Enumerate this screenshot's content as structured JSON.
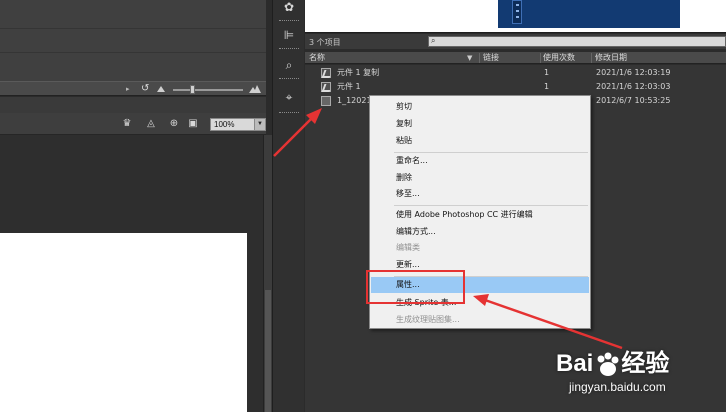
{
  "stage": {
    "zoom": "100%"
  },
  "library": {
    "item_count": "3 个项目",
    "search_placeholder": "",
    "columns": {
      "name": "名称",
      "linkage": "链接",
      "use_count": "使用次数",
      "modified": "修改日期"
    },
    "rows": [
      {
        "name": "元件 1 复制",
        "use_count": "1",
        "modified": "2021/1/6 12:03:19",
        "icon": "symbol-icon"
      },
      {
        "name": "元件 1",
        "use_count": "1",
        "modified": "2021/1/6 12:03:03",
        "icon": "symbol-icon"
      },
      {
        "name": "1_12021",
        "use_count": "1",
        "modified": "2012/6/7 10:53:25",
        "icon": "bitmap-icon"
      }
    ]
  },
  "context_menu": {
    "items": [
      {
        "label": "剪切",
        "enabled": true
      },
      {
        "label": "复制",
        "enabled": true
      },
      {
        "label": "粘贴",
        "enabled": true
      },
      {
        "label": "重命名...",
        "enabled": true
      },
      {
        "label": "删除",
        "enabled": true
      },
      {
        "label": "移至...",
        "enabled": true
      },
      {
        "label": "使用 Adobe Photoshop CC 进行编辑",
        "enabled": true
      },
      {
        "label": "编辑方式...",
        "enabled": true
      },
      {
        "label": "编辑类",
        "enabled": false
      },
      {
        "label": "更新...",
        "enabled": true
      },
      {
        "label": "属性...",
        "enabled": true,
        "highlighted": true
      },
      {
        "label": "生成 Sprite 表...",
        "enabled": true
      },
      {
        "label": "生成纹理贴图集...",
        "enabled": false
      }
    ]
  },
  "watermark": {
    "logo_text_left": "Bai",
    "logo_text_right": "经验",
    "url": "jingyan.baidu.com"
  },
  "colors": {
    "highlight": "#99c9f5",
    "annotation": "#e53333"
  }
}
